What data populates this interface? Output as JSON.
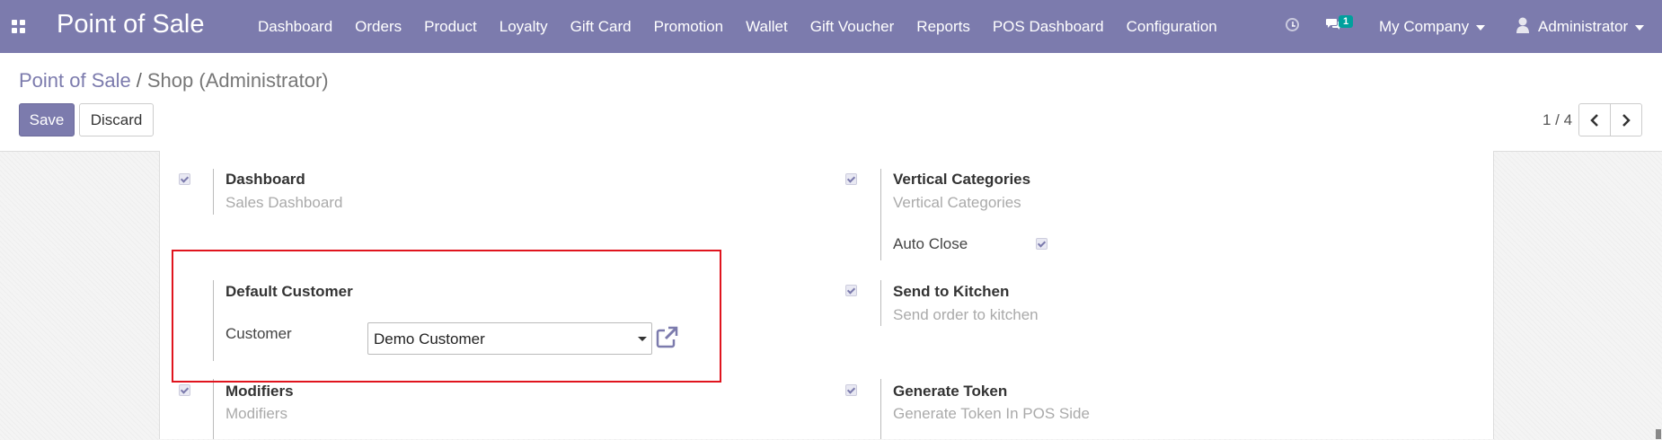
{
  "navbar": {
    "brand": "Point of Sale",
    "menu": [
      "Dashboard",
      "Orders",
      "Product",
      "Loyalty",
      "Gift Card",
      "Promotion",
      "Wallet",
      "Gift Voucher",
      "Reports",
      "POS Dashboard",
      "Configuration"
    ],
    "message_count": "1",
    "company": "My Company",
    "user": "Administrator"
  },
  "breadcrumb": {
    "parent": "Point of Sale",
    "separator": "/",
    "current": "Shop (Administrator)"
  },
  "actions": {
    "save": "Save",
    "discard": "Discard"
  },
  "pager": {
    "value": "1 / 4"
  },
  "settings": {
    "dashboard": {
      "title": "Dashboard",
      "desc": "Sales Dashboard",
      "checked": true
    },
    "vertical_categories": {
      "title": "Vertical Categories",
      "desc": "Vertical Categories",
      "checked": true,
      "auto_close_label": "Auto Close",
      "auto_close_checked": true
    },
    "default_customer": {
      "title": "Default Customer",
      "customer_label": "Customer",
      "customer_value": "Demo Customer"
    },
    "send_to_kitchen": {
      "title": "Send to Kitchen",
      "desc": "Send order to kitchen",
      "checked": true
    },
    "modifiers": {
      "title": "Modifiers",
      "desc": "Modifiers",
      "checked": true
    },
    "generate_token": {
      "title": "Generate Token",
      "desc": "Generate Token In POS Side",
      "checked": true
    }
  },
  "colors": {
    "brand": "#7c7bad",
    "highlight": "#e0141e",
    "badge": "#00a09d"
  }
}
